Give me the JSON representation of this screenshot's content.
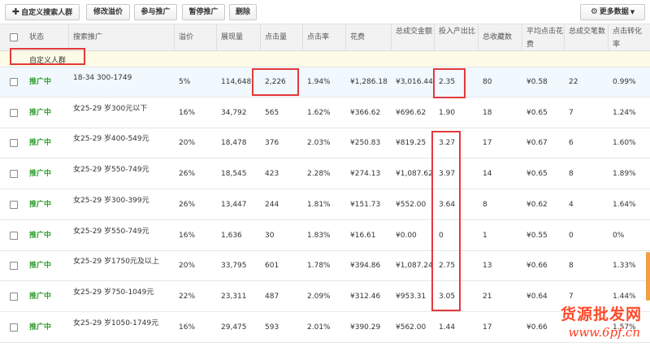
{
  "toolbar": {
    "add_custom": "自定义搜索人群",
    "modify_premium": "修改溢价",
    "join_promo": "参与推广",
    "pause_promo": "暂停推广",
    "delete": "删除",
    "more_data": "更多数据"
  },
  "headers": {
    "status": "状态",
    "keyword": "搜索推广",
    "premium": "溢价",
    "impressions": "展现量",
    "clicks": "点击量",
    "ctr": "点击率",
    "cost": "花费",
    "total_deals": "总成交金额",
    "roi": "投入产出比",
    "favorites": "总收藏数",
    "avg_click_cost": "平均点击花费",
    "total_orders": "总成交笔数",
    "conversion": "点击转化率"
  },
  "group": {
    "label": "自定义人群"
  },
  "rows": [
    {
      "status": "推广中",
      "keyword": "18-34 300-1749",
      "premium": "5%",
      "impressions": "114,648",
      "clicks": "2,226",
      "ctr": "1.94%",
      "cost": "¥1,286.18",
      "deals": "¥3,016.44",
      "roi": "2.35",
      "fav": "80",
      "avg": "¥0.58",
      "orders": "22",
      "conv": "0.99%"
    },
    {
      "status": "推广中",
      "keyword": "女25-29 岁300元以下",
      "premium": "16%",
      "impressions": "34,792",
      "clicks": "565",
      "ctr": "1.62%",
      "cost": "¥366.62",
      "deals": "¥696.62",
      "roi": "1.90",
      "fav": "18",
      "avg": "¥0.65",
      "orders": "7",
      "conv": "1.24%"
    },
    {
      "status": "推广中",
      "keyword": "女25-29 岁400-549元",
      "premium": "20%",
      "impressions": "18,478",
      "clicks": "376",
      "ctr": "2.03%",
      "cost": "¥250.83",
      "deals": "¥819.25",
      "roi": "3.27",
      "fav": "17",
      "avg": "¥0.67",
      "orders": "6",
      "conv": "1.60%"
    },
    {
      "status": "推广中",
      "keyword": "女25-29 岁550-749元",
      "premium": "26%",
      "impressions": "18,545",
      "clicks": "423",
      "ctr": "2.28%",
      "cost": "¥274.13",
      "deals": "¥1,087.62",
      "roi": "3.97",
      "fav": "14",
      "avg": "¥0.65",
      "orders": "8",
      "conv": "1.89%"
    },
    {
      "status": "推广中",
      "keyword": "女25-29 岁300-399元",
      "premium": "26%",
      "impressions": "13,447",
      "clicks": "244",
      "ctr": "1.81%",
      "cost": "¥151.73",
      "deals": "¥552.00",
      "roi": "3.64",
      "fav": "8",
      "avg": "¥0.62",
      "orders": "4",
      "conv": "1.64%"
    },
    {
      "status": "推广中",
      "keyword": "女25-29 岁550-749元",
      "premium": "16%",
      "impressions": "1,636",
      "clicks": "30",
      "ctr": "1.83%",
      "cost": "¥16.61",
      "deals": "¥0.00",
      "roi": "0",
      "fav": "1",
      "avg": "¥0.55",
      "orders": "0",
      "conv": "0%"
    },
    {
      "status": "推广中",
      "keyword": "女25-29 岁1750元及以上",
      "premium": "20%",
      "impressions": "33,795",
      "clicks": "601",
      "ctr": "1.78%",
      "cost": "¥394.86",
      "deals": "¥1,087.24",
      "roi": "2.75",
      "fav": "13",
      "avg": "¥0.66",
      "orders": "8",
      "conv": "1.33%"
    },
    {
      "status": "推广中",
      "keyword": "女25-29 岁750-1049元",
      "premium": "22%",
      "impressions": "23,311",
      "clicks": "487",
      "ctr": "2.09%",
      "cost": "¥312.46",
      "deals": "¥953.31",
      "roi": "3.05",
      "fav": "21",
      "avg": "¥0.64",
      "orders": "7",
      "conv": "1.44%"
    },
    {
      "status": "推广中",
      "keyword": "女25-29 岁1050-1749元",
      "premium": "16%",
      "impressions": "29,475",
      "clicks": "593",
      "ctr": "2.01%",
      "cost": "¥390.29",
      "deals": "¥562.00",
      "roi": "1.44",
      "fav": "17",
      "avg": "¥0.66",
      "orders": "",
      "conv": "1.57%"
    }
  ],
  "watermark": {
    "line1": "货源批发网",
    "line2": "www.6pf.cn"
  },
  "colors": {
    "status_green": "#2f9e2f",
    "highlight_red": "#e4393c",
    "watermark": "#ff4a2a"
  }
}
